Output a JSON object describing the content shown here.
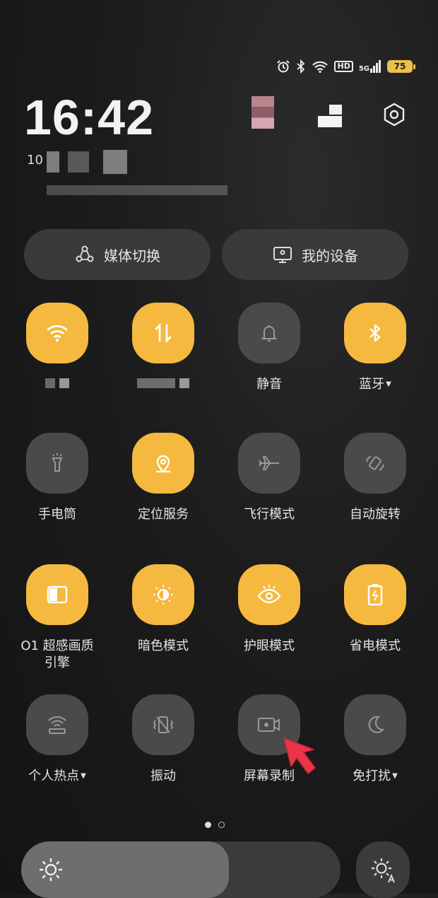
{
  "status_bar": {
    "icons": [
      "alarm-icon",
      "bluetooth-icon",
      "wifi-icon",
      "hd-icon",
      "5g-signal-icon"
    ],
    "hd": "HD",
    "network": "5G",
    "battery": "75"
  },
  "header": {
    "time": "16:42",
    "date_prefix": "10"
  },
  "shortcuts": {
    "media_switch": "媒体切换",
    "my_devices": "我的设备"
  },
  "tiles": [
    {
      "id": "wifi",
      "label": "",
      "active": true,
      "icon": "wifi-icon"
    },
    {
      "id": "mobile-data",
      "label": "",
      "active": true,
      "icon": "data-arrows-icon"
    },
    {
      "id": "mute",
      "label": "静音",
      "active": false,
      "icon": "bell-icon"
    },
    {
      "id": "bluetooth",
      "label": "蓝牙",
      "active": true,
      "icon": "bluetooth-icon",
      "dropdown": true
    },
    {
      "id": "flashlight",
      "label": "手电筒",
      "active": false,
      "icon": "flashlight-icon"
    },
    {
      "id": "location",
      "label": "定位服务",
      "active": true,
      "icon": "location-icon"
    },
    {
      "id": "airplane",
      "label": "飞行模式",
      "active": false,
      "icon": "airplane-icon"
    },
    {
      "id": "auto-rotate",
      "label": "自动旋转",
      "active": false,
      "icon": "rotate-icon"
    },
    {
      "id": "o1-display",
      "label": "O1 超感画质\n引擎",
      "active": true,
      "icon": "display-engine-icon"
    },
    {
      "id": "dark-mode",
      "label": "暗色模式",
      "active": true,
      "icon": "dark-mode-icon"
    },
    {
      "id": "eye-comfort",
      "label": "护眼模式",
      "active": true,
      "icon": "eye-icon"
    },
    {
      "id": "power-saving",
      "label": "省电模式",
      "active": true,
      "icon": "battery-saver-icon"
    },
    {
      "id": "hotspot",
      "label": "个人热点",
      "active": false,
      "icon": "hotspot-icon",
      "dropdown": true
    },
    {
      "id": "vibrate",
      "label": "振动",
      "active": false,
      "icon": "vibrate-icon"
    },
    {
      "id": "screen-record",
      "label": "屏幕录制",
      "active": false,
      "icon": "screen-record-icon"
    },
    {
      "id": "dnd",
      "label": "免打扰",
      "active": false,
      "icon": "moon-icon",
      "dropdown": true
    }
  ],
  "pagination": {
    "pages": 2,
    "current": 1
  },
  "brightness": {
    "level": 0.65,
    "auto_icon": "auto-brightness-icon"
  },
  "colors": {
    "accent": "#f5b93f",
    "tile_off": "#4a4a4a",
    "pointer": "#e8354a"
  }
}
